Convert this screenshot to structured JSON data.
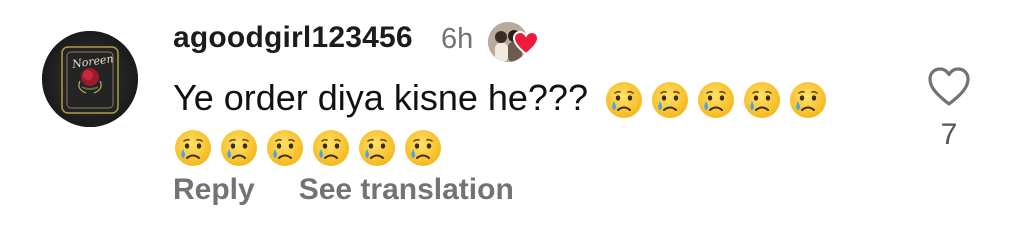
{
  "comment": {
    "username": "agoodgirl123456",
    "timestamp": "6h",
    "avatar_text": "Noreen",
    "text": "Ye order diya kisne he???",
    "emoji_line1_count": 5,
    "emoji_line2_count": 6,
    "emoji_name": "crying-face",
    "actions": {
      "reply": "Reply",
      "see_translation": "See translation"
    },
    "like_count": "7",
    "liked_by_author": true
  },
  "colors": {
    "heart_badge": "#ed1c3c",
    "secondary_text": "#737373"
  }
}
